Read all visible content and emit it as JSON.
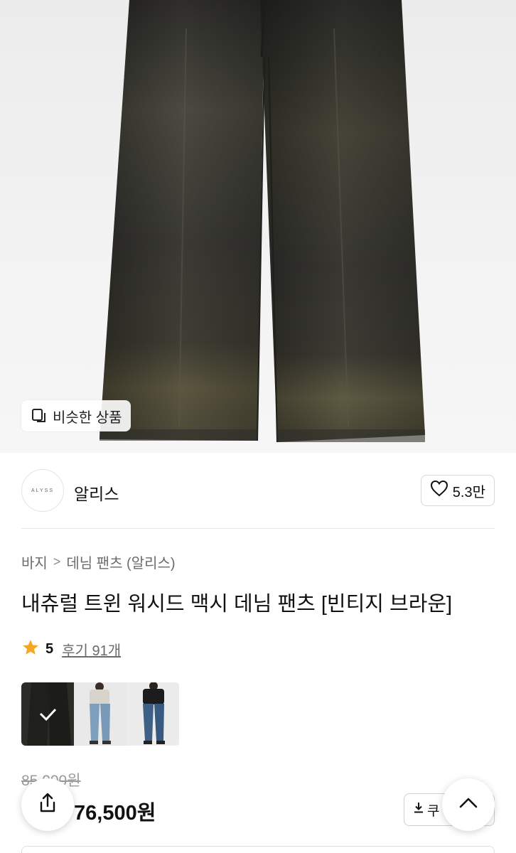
{
  "hero": {
    "similar_label": "비슷한 상품"
  },
  "brand": {
    "logo_text": "ALYSS",
    "name": "알리스",
    "likes": "5.3만"
  },
  "breadcrumb": {
    "category": "바지",
    "separator": ">",
    "subcategory": "데님 팬츠 (알리스)"
  },
  "product": {
    "title": "내츄럴 트윈 워시드 맥시 데님 팬츠 [빈티지 브라운]",
    "rating": "5",
    "reviews": "후기 91개",
    "original_price": "85,000원",
    "sale_price": "76,500원",
    "coupon_label": "쿠"
  },
  "colors": {
    "star": "#f5a623",
    "text_primary": "#111111",
    "text_secondary": "#6b6b6b"
  }
}
